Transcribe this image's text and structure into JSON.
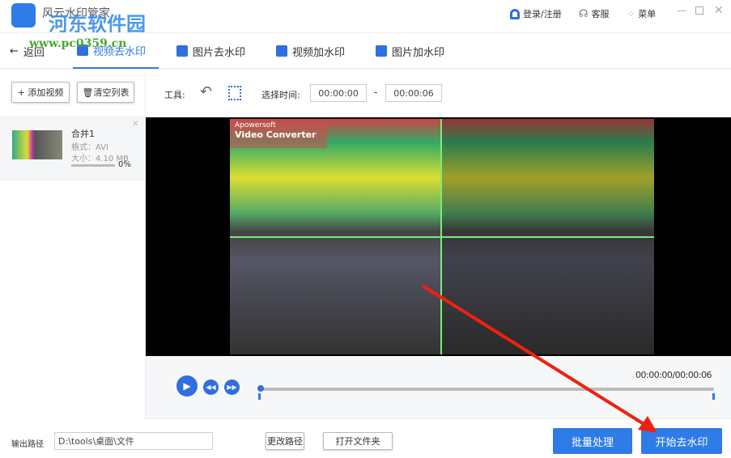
{
  "app": {
    "title": "风云水印管家",
    "login": "登录/注册",
    "service": "客服",
    "menu": "菜单"
  },
  "watermark": {
    "site": "河东软件园",
    "url": "www.pc0359.cn"
  },
  "nav": {
    "back": "返回",
    "tabs": [
      {
        "label": "视频去水印"
      },
      {
        "label": "图片去水印"
      },
      {
        "label": "视频加水印"
      },
      {
        "label": "图片加水印"
      }
    ]
  },
  "sidebar": {
    "add": "+ 添加视频",
    "clear": "清空列表",
    "file": {
      "name": "合并1",
      "format": "格式：AVI",
      "size": "大小：4.10 MB",
      "progress": "0%",
      "progress_value": 0
    }
  },
  "toolbar": {
    "tools_label": "工具:",
    "time_label": "选择时间:",
    "start": "00:00:00",
    "dash": "-",
    "end": "00:00:06"
  },
  "video": {
    "overlay_brand": "Apowersoft",
    "overlay_title": "Video Converter"
  },
  "player": {
    "time": "00:00:00/00:00:06",
    "position": 0
  },
  "bottom": {
    "output_label": "输出路径",
    "output_path": "D:\\tools\\桌面\\文件",
    "change": "更改路径",
    "open": "打开文件夹",
    "batch": "批量处理",
    "start": "开始去水印"
  },
  "colors": {
    "accent": "#2f7be8",
    "arrow": "#f02010"
  }
}
